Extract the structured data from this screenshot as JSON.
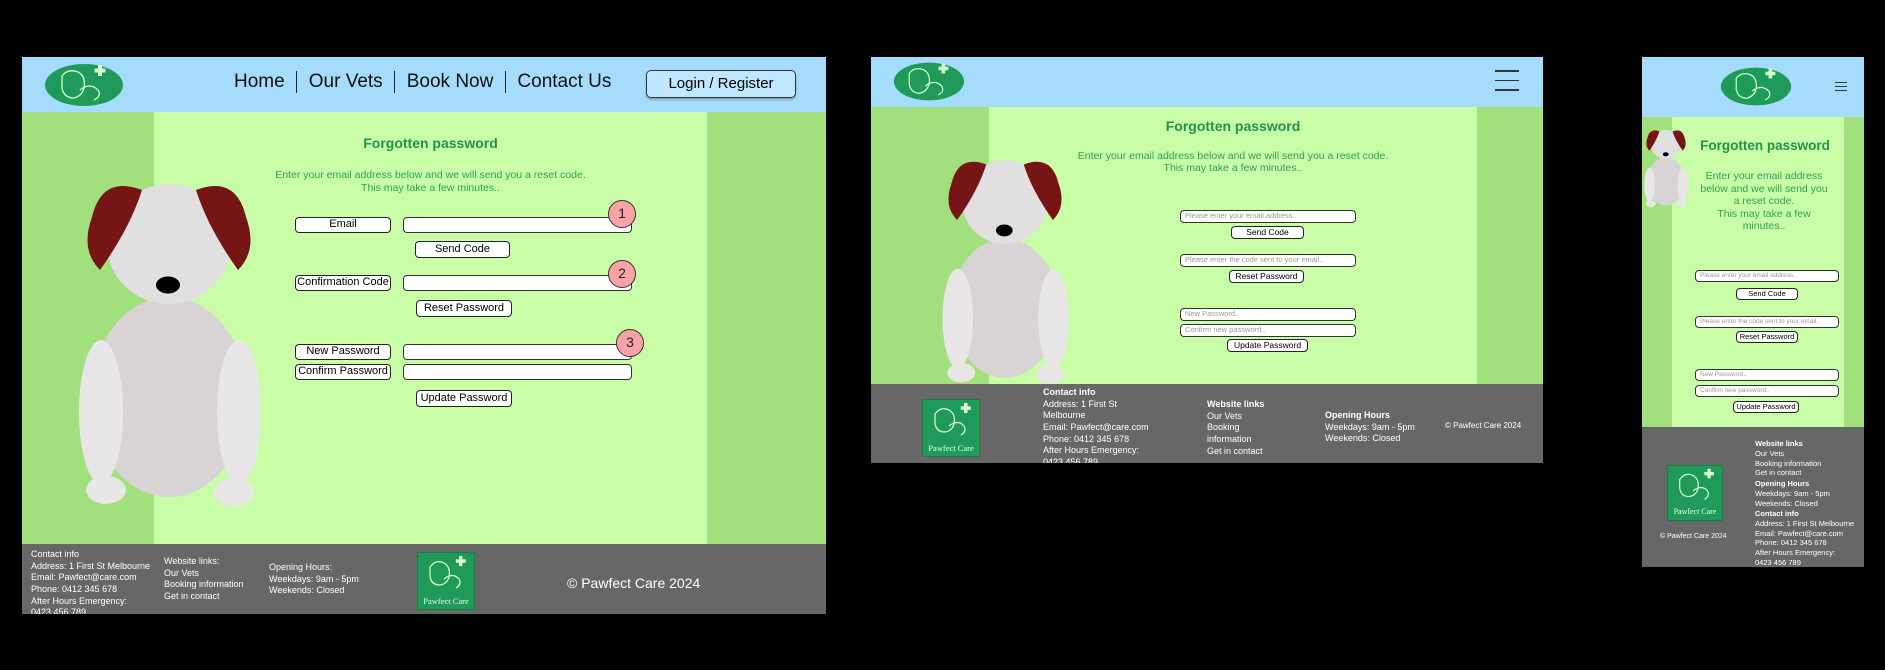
{
  "brand": {
    "name": "Pawfect Care"
  },
  "colors": {
    "header": "#a5dcfc",
    "page": "#c8fca6",
    "side": "#a2e07e",
    "footer": "#676767",
    "heading": "#22934c",
    "badge": "#f8a3a6",
    "logo": "#1f9a58"
  },
  "nav": {
    "items": [
      "Home",
      "Our Vets",
      "Book Now",
      "Contact Us"
    ],
    "login": "Login / Register"
  },
  "page": {
    "title": "Forgotten password",
    "intro": "Enter your email address below and we will send you a reset code.",
    "intro_note": "This may take a few minutes..",
    "intro_mobile_1": "Enter your email address",
    "intro_mobile_2": "below and we will send you",
    "intro_mobile_3": "a reset code.",
    "intro_mobile_4": "This may take a few",
    "intro_mobile_5": "minutes.."
  },
  "form": {
    "email_label": "Email",
    "send_code": "Send Code",
    "code_label": "Confirmation Code",
    "reset_password": "Reset Password",
    "new_password_label": "New Password",
    "confirm_password_label": "Confirm Password",
    "update_password": "Update Password",
    "email_placeholder": "Please enter your email address..",
    "code_placeholder": "Please enter the code sent to your email..",
    "new_password_placeholder": "New Password..",
    "confirm_password_placeholder": "Confirm new password.."
  },
  "annotations": [
    "1",
    "2",
    "3"
  ],
  "footer": {
    "contact_title": "Contact info",
    "contact_title_alt": "Contact info",
    "address": "Address: 1 First St Melbourne",
    "address_line1": "Address: 1 First St",
    "address_line2": "Melbourne",
    "email": "Email: Pawfect@care.com",
    "phone": "Phone: 0412 345 678",
    "emergency": "After Hours Emergency:",
    "emergency_phone": "0423 456 789",
    "links_title_desktop": "Website links:",
    "links_title": "Website links",
    "links": [
      "Our Vets",
      "Booking information",
      "Get in contact"
    ],
    "tablet_links": [
      "Our Vets",
      "Booking",
      "information",
      "Get in contact"
    ],
    "hours_title_desktop": "Opening Hours:",
    "hours_title": "Opening Hours",
    "weekdays": "Weekdays: 9am - 5pm",
    "weekends": "Weekends: Closed",
    "copyright": "© Pawfect Care 2024"
  },
  "icons": {
    "logo": "dog-cat-logo-icon",
    "menu": "hamburger-menu-icon",
    "dog": "dog-illustration"
  }
}
